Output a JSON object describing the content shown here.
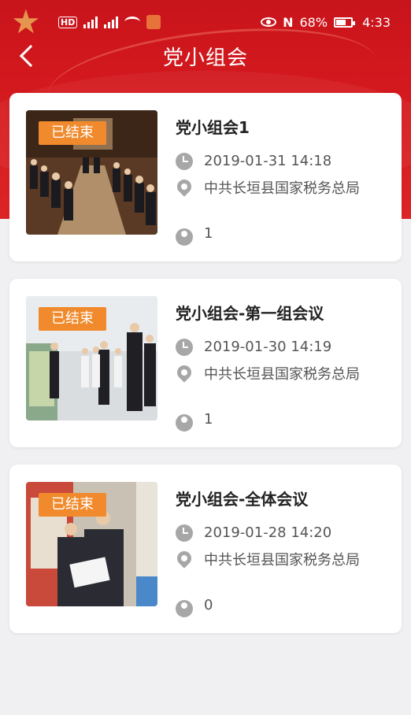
{
  "status_bar": {
    "hd": "HD",
    "battery_percent": "68%",
    "time": "4:33",
    "battery_level": 0.68
  },
  "nav": {
    "title": "党小组会"
  },
  "meetings": [
    {
      "badge": "已结束",
      "title": "党小组会1",
      "time": "2019-01-31 14:18",
      "location": "中共长垣县国家税务总局",
      "views": "1"
    },
    {
      "badge": "已结束",
      "title": "党小组会-第一组会议",
      "time": "2019-01-30 14:19",
      "location": "中共长垣县国家税务总局",
      "views": "1"
    },
    {
      "badge": "已结束",
      "title": "党小组会-全体会议",
      "time": "2019-01-28 14:20",
      "location": "中共长垣县国家税务总局",
      "views": "0"
    }
  ],
  "colors": {
    "header_red": "#d4191e",
    "badge_orange": "#f08a2c",
    "icon_gray": "#a7a7a7"
  }
}
